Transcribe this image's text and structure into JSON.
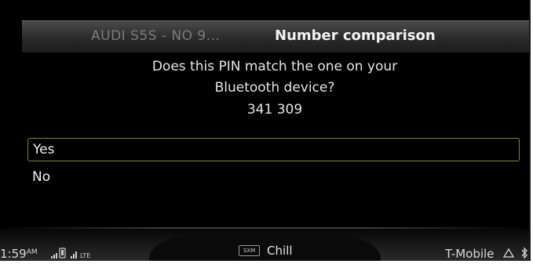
{
  "title_bar": {
    "previous_title": "AUDI S5S - NO 9...",
    "title": "Number comparison"
  },
  "prompt": {
    "line1": "Does this PIN match the one on your",
    "line2": "Bluetooth device?",
    "pin": "341 309"
  },
  "options": [
    {
      "label": "Yes",
      "selected": true
    },
    {
      "label": "No",
      "selected": false
    }
  ],
  "status_bar": {
    "time": "1:59",
    "ampm": "AM",
    "network": "LTE",
    "source": "SXM",
    "station": "Chill",
    "carrier": "T-Mobile"
  },
  "colors": {
    "selection_border": "#7a8a1e",
    "background": "#000000",
    "text": "#e6e6e6"
  }
}
